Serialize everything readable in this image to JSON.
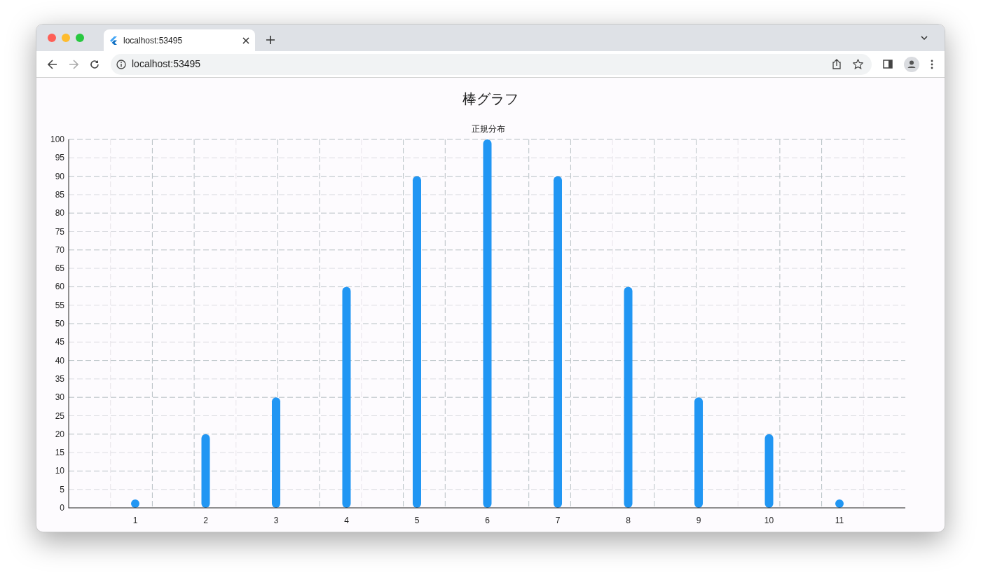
{
  "browser": {
    "tab_title": "localhost:53495",
    "url": "localhost:53495"
  },
  "page": {
    "title": "棒グラフ",
    "chart_data": {
      "type": "bar",
      "title": "正規分布",
      "categories": [
        "1",
        "2",
        "3",
        "4",
        "5",
        "6",
        "7",
        "8",
        "9",
        "10",
        "11"
      ],
      "grid": true,
      "series": [
        {
          "color": "#2196f3",
          "values": [
            2,
            20,
            30,
            60,
            90,
            100,
            90,
            60,
            30,
            20,
            2
          ]
        }
      ],
      "ylim": [
        0,
        100
      ],
      "yticks": [
        0,
        5,
        10,
        15,
        20,
        25,
        30,
        35,
        40,
        45,
        50,
        55,
        60,
        65,
        70,
        75,
        80,
        85,
        90,
        95,
        100
      ]
    }
  }
}
